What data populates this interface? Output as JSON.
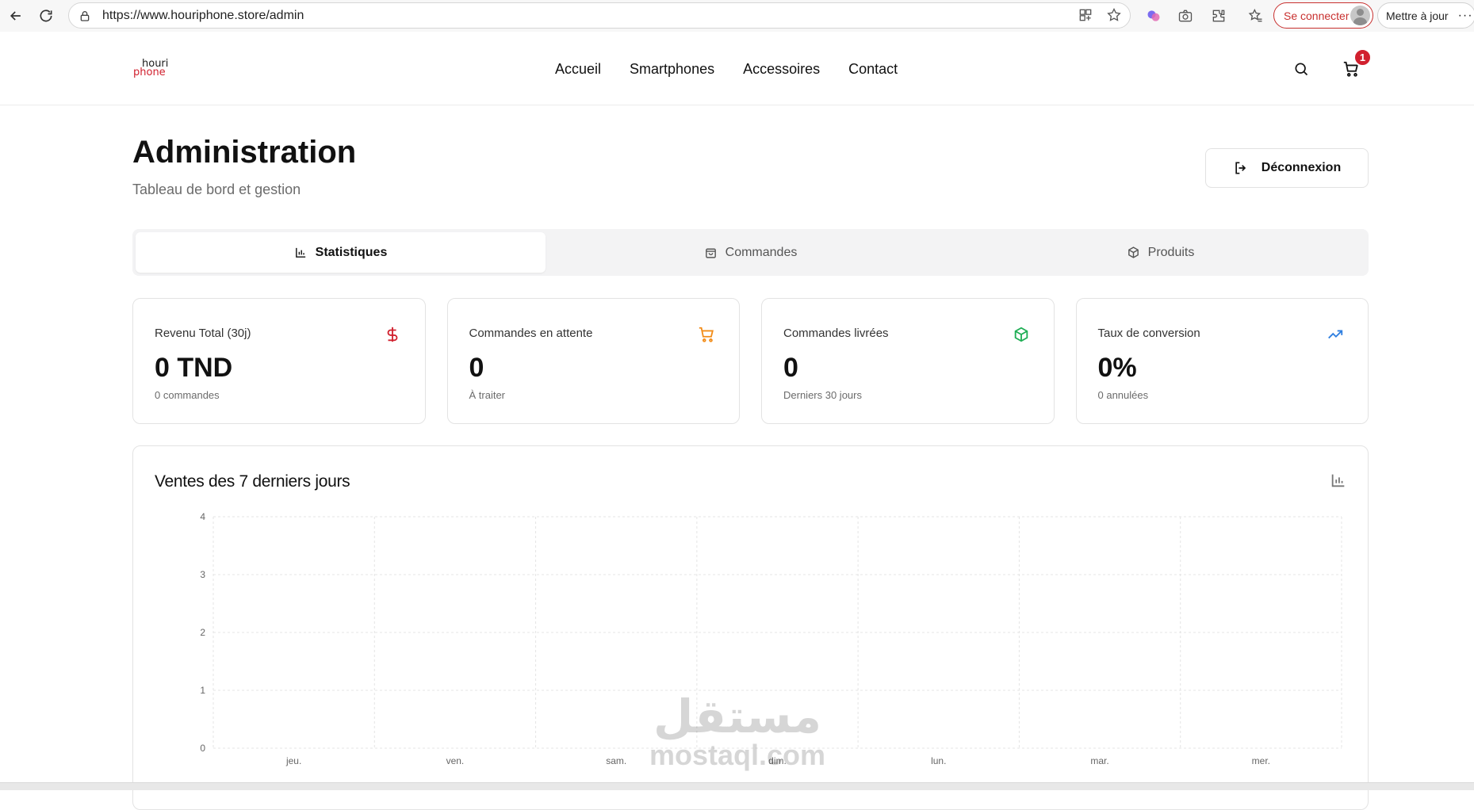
{
  "browser": {
    "url": "https://www.houriphone.store/admin",
    "signin_label": "Se connecter",
    "update_label": "Mettre à jour",
    "more_label": "···"
  },
  "header": {
    "logo_top": "houri",
    "logo_bottom": "phone",
    "nav": [
      "Accueil",
      "Smartphones",
      "Accessoires",
      "Contact"
    ],
    "cart_count": "1"
  },
  "page": {
    "title": "Administration",
    "subtitle": "Tableau de bord et gestion",
    "logout_label": "Déconnexion"
  },
  "tabs": [
    {
      "label": "Statistiques",
      "icon": "bar-chart-icon",
      "active": true
    },
    {
      "label": "Commandes",
      "icon": "shopping-bag-icon",
      "active": false
    },
    {
      "label": "Produits",
      "icon": "package-icon",
      "active": false
    }
  ],
  "stats": [
    {
      "title": "Revenu Total (30j)",
      "value": "0 TND",
      "sub": "0 commandes",
      "icon": "dollar-icon",
      "color": "#d1202e"
    },
    {
      "title": "Commandes en attente",
      "value": "0",
      "sub": "À traiter",
      "icon": "cart-icon",
      "color": "#f28c18"
    },
    {
      "title": "Commandes livrées",
      "value": "0",
      "sub": "Derniers 30 jours",
      "icon": "package-icon",
      "color": "#1fae55"
    },
    {
      "title": "Taux de conversion",
      "value": "0%",
      "sub": "0 annulées",
      "icon": "trending-up-icon",
      "color": "#2f7fe0"
    }
  ],
  "chart": {
    "title": "Ventes des 7 derniers jours"
  },
  "chart_data": {
    "type": "bar",
    "categories": [
      "jeu.",
      "ven.",
      "sam.",
      "dim.",
      "lun.",
      "mar.",
      "mer."
    ],
    "values": [
      0,
      0,
      0,
      0,
      0,
      0,
      0
    ],
    "title": "Ventes des 7 derniers jours",
    "xlabel": "",
    "ylabel": "",
    "ylim": [
      0,
      4
    ],
    "yticks": [
      0,
      1,
      2,
      3,
      4
    ],
    "grid": true
  },
  "watermark": {
    "arabic": "مستقل",
    "latin": "mostaql.com"
  }
}
